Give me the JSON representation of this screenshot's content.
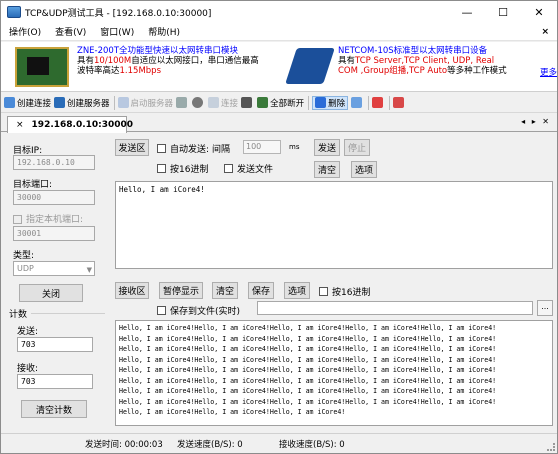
{
  "window": {
    "title": "TCP&UDP测试工具 - [192.168.0.10:30000]",
    "min": "—",
    "max": "☐",
    "close": "✕"
  },
  "menu": {
    "items": [
      "操作(O)",
      "查看(V)",
      "窗口(W)",
      "帮助(H)"
    ],
    "close": "×"
  },
  "ad": {
    "line1": "ZNE-200T全功能型快速以太网转串口模块",
    "line2a": "具有",
    "line2b": "10/100M",
    "line2c": "自适应以太网接口，串口通信最高",
    "line3a": "波特率高达",
    "line3b": "1.15Mbps",
    "r1": "NETCOM-10S标准型以太网转串口设备",
    "r2a": "具有",
    "r2b": "TCP Server,TCP Client, UDP, Real",
    "r3a": "COM ,Group组播,TCP Auto",
    "r3b": "等多种工作模式",
    "more": "更多"
  },
  "toolbar": {
    "create_conn": "创建连接",
    "create_server": "创建服务器",
    "auto_server": "启动服务器",
    "connect": "连接",
    "disconnect_all": "全部断开",
    "delete": "删除"
  },
  "tab": {
    "label": "192.168.0.10:30000",
    "close": "×",
    "nav": "◂ ▸ ✕"
  },
  "left": {
    "target_ip_label": "目标IP:",
    "target_ip": "192.168.0.10",
    "target_port_label": "目标端口:",
    "target_port": "30000",
    "local_port_label": "指定本机端口:",
    "local_port": "30001",
    "type_label": "类型:",
    "type_value": "UDP",
    "close_btn": "关闭",
    "count_label": "计数",
    "send_label": "发送:",
    "send_count": "703",
    "recv_label": "接收:",
    "recv_count": "703",
    "clear_count_btn": "清空计数"
  },
  "send": {
    "area_btn": "发送区",
    "auto_send": "自动发送:",
    "interval_label": "间隔",
    "interval_value": "100",
    "ms": "ms",
    "send_btn": "发送",
    "stop_btn": "停止",
    "hex": "按16进制",
    "send_file": "发送文件",
    "clear_btn": "清空",
    "options_btn": "选项",
    "content": "Hello, I am iCore4!"
  },
  "recv": {
    "area_btn": "接收区",
    "pause_btn": "暂停显示",
    "clear_btn": "清空",
    "save_btn": "保存",
    "options_btn": "选项",
    "hex": "按16进制",
    "save_file": "保存到文件(实时)",
    "browse": "...",
    "lines": [
      "Hello, I am iCore4!Hello, I am iCore4!Hello, I am iCore4!Hello, I am iCore4!Hello, I am iCore4!",
      "Hello, I am iCore4!Hello, I am iCore4!Hello, I am iCore4!Hello, I am iCore4!Hello, I am iCore4!",
      "Hello, I am iCore4!Hello, I am iCore4!Hello, I am iCore4!Hello, I am iCore4!Hello, I am iCore4!",
      "Hello, I am iCore4!Hello, I am iCore4!Hello, I am iCore4!Hello, I am iCore4!Hello, I am iCore4!",
      "Hello, I am iCore4!Hello, I am iCore4!Hello, I am iCore4!Hello, I am iCore4!Hello, I am iCore4!",
      "Hello, I am iCore4!Hello, I am iCore4!Hello, I am iCore4!Hello, I am iCore4!Hello, I am iCore4!",
      "Hello, I am iCore4!Hello, I am iCore4!Hello, I am iCore4!Hello, I am iCore4!Hello, I am iCore4!",
      "Hello, I am iCore4!Hello, I am iCore4!Hello, I am iCore4!Hello, I am iCore4!Hello, I am iCore4!",
      "Hello, I am iCore4!Hello, I am iCore4!Hello, I am iCore4!"
    ]
  },
  "status": {
    "send_time": "发送时间: 00:00:03",
    "send_speed": "发送速度(B/S): 0",
    "recv_speed": "接收速度(B/S): 0"
  }
}
